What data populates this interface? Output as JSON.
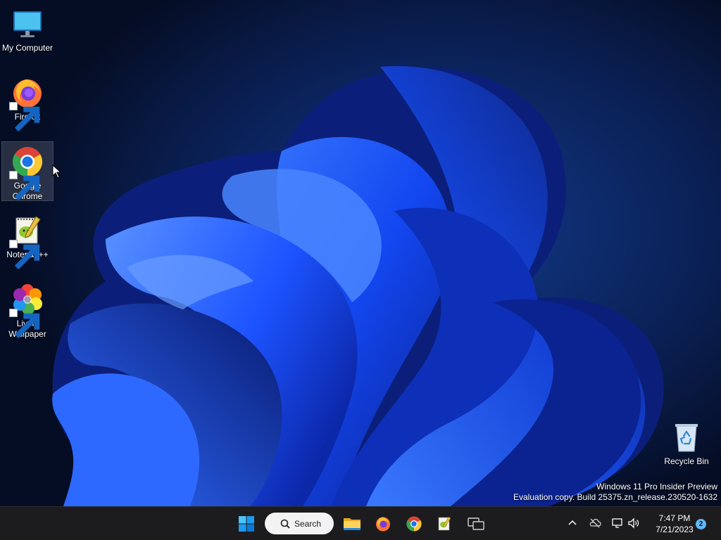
{
  "desktop": {
    "icons": [
      {
        "label": "My Computer",
        "icon": "monitor-icon",
        "shortcut": false
      },
      {
        "label": "Firefox",
        "icon": "firefox-icon",
        "shortcut": true
      },
      {
        "label": "Google Chrome",
        "icon": "chrome-icon",
        "shortcut": true,
        "selected": true
      },
      {
        "label": "Notepad++",
        "icon": "notepadpp-icon",
        "shortcut": true
      },
      {
        "label": "Lively Wallpaper",
        "icon": "lively-wallpaper-icon",
        "shortcut": true
      },
      {
        "label": "Recycle Bin",
        "icon": "recycle-bin-icon",
        "shortcut": false
      }
    ],
    "watermark": {
      "line1": "Windows 11 Pro Insider Preview",
      "line2": "Evaluation copy. Build 25375.zn_release.230520-1632"
    }
  },
  "taskbar": {
    "search_label": "Search",
    "pinned": [
      "start-icon",
      "file-explorer-icon",
      "firefox-icon",
      "chrome-icon",
      "notepadpp-icon",
      "task-view-icon"
    ],
    "clock": {
      "time": "7:47 PM",
      "date": "7/21/2023"
    },
    "notification_count": "2"
  },
  "colors": {
    "accent": "#1f5fff",
    "taskbar_bg": "#1c1c1f",
    "badge": "#60b8f6"
  }
}
